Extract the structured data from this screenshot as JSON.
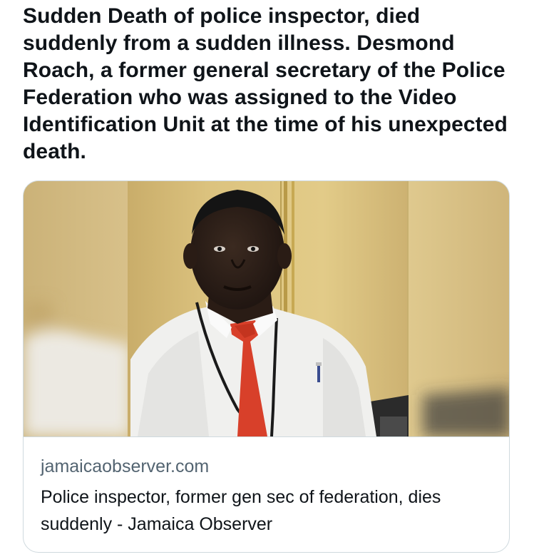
{
  "tweet": {
    "text": "Sudden Death of police inspector, died suddenly from a sudden illness. Desmond Roach, a former general secretary of the Police Federation who was assigned to the Video Identification Unit at the time of his unexpected death."
  },
  "link_card": {
    "domain": "jamaicaobserver.com",
    "title": "Police inspector, former gen sec of federation, dies suddenly - Jamaica Observer",
    "image_description": "photo-of-man-in-white-shirt-and-red-tie"
  },
  "colors": {
    "text_primary": "#0f1419",
    "text_secondary": "#536471",
    "card_border": "#cfd9de",
    "wall_yellow": "#d9c07a",
    "tie_red": "#d8402a",
    "shirt_white": "#f2f2f0"
  }
}
